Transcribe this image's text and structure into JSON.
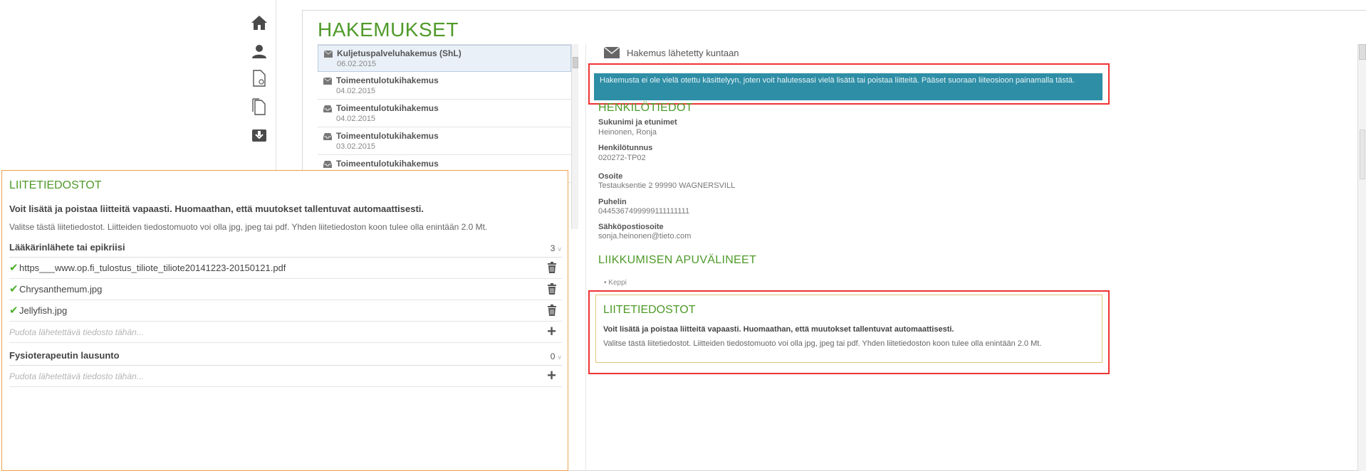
{
  "nav": {
    "icons": [
      "home-icon",
      "user-icon",
      "new-document-icon",
      "documents-icon",
      "inbox-icon"
    ]
  },
  "page": {
    "title": "HAKEMUKSET"
  },
  "applications": [
    {
      "name": "Kuljetuspalveluhakemus (ShL)",
      "date": "06.02.2015",
      "icon": "envelope-icon",
      "selected": true
    },
    {
      "name": "Toimeentulotukihakemus",
      "date": "04.02.2015",
      "icon": "envelope-icon",
      "selected": false
    },
    {
      "name": "Toimeentulotukihakemus",
      "date": "04.02.2015",
      "icon": "inbox-tray-icon",
      "selected": false
    },
    {
      "name": "Toimeentulotukihakemus",
      "date": "03.02.2015",
      "icon": "inbox-tray-icon",
      "selected": false
    },
    {
      "name": "Toimeentulotukihakemus",
      "date": "",
      "icon": "inbox-tray-icon",
      "selected": false
    }
  ],
  "detail": {
    "status": "Hakemus lähetetty kuntaan",
    "banner": "Hakemusta ei ole vielä otettu käsittelyyn, joten voit halutessasi vielä lisätä tai poistaa liitteitä. Pääset suoraan liiteosioon painamalla tästä.",
    "personal_title": "HENKILÖTIEDOT",
    "fields": [
      {
        "label": "Sukunimi ja etunimet",
        "value": "Heinonen, Ronja"
      },
      {
        "label": "Henkilötunnus",
        "value": "020272-TP02"
      },
      {
        "label": "Osoite",
        "value": "Testauksentie 2 99990 WAGNERSVILL"
      },
      {
        "label": "Puhelin",
        "value": "0445367499999111111111"
      },
      {
        "label": "Sähköpostiosoite",
        "value": "sonja.heinonen@tieto.com"
      }
    ],
    "mobility_title": "LIIKKUMISEN APUVÄLINEET",
    "mobility_items": [
      "Keppi"
    ],
    "attachments_card": {
      "title": "LIITETIEDOSTOT",
      "bold": "Voit lisätä ja poistaa liitteitä vapaasti. Huomaathan, että muutokset tallentuvat automaattisesti.",
      "note": "Valitse tästä liitetiedostot. Liitteiden tiedostomuoto voi olla jpg, jpeg tai pdf. Yhden liitetiedoston koon tulee olla enintään 2.0 Mt."
    }
  },
  "overlay": {
    "title": "LIITETIEDOSTOT",
    "bold": "Voit lisätä ja poistaa liitteitä vapaasti. Huomaathan, että muutokset tallentuvat automaattisesti.",
    "note": "Valitse tästä liitetiedostot. Liitteiden tiedostomuoto voi olla jpg, jpeg tai pdf. Yhden liitetiedoston koon tulee olla enintään 2.0 Mt.",
    "groups": [
      {
        "title": "Lääkärinlähete tai epikriisi",
        "count": "3",
        "files": [
          "https___www.op.fi_tulostus_tiliote_tiliote20141223-20150121.pdf",
          "Chrysanthemum.jpg",
          "Jellyfish.jpg"
        ],
        "drop_placeholder": "Pudota lähetettävä tiedosto tähän..."
      },
      {
        "title": "Fysioterapeutin lausunto",
        "count": "0",
        "files": [],
        "drop_placeholder": "Pudota lähetettävä tiedosto tähän..."
      }
    ]
  },
  "colors": {
    "accent_green": "#4f9a2a",
    "banner_teal": "#2e8ea6",
    "highlight_red": "#e33333",
    "overlay_border": "#f0a24a"
  }
}
